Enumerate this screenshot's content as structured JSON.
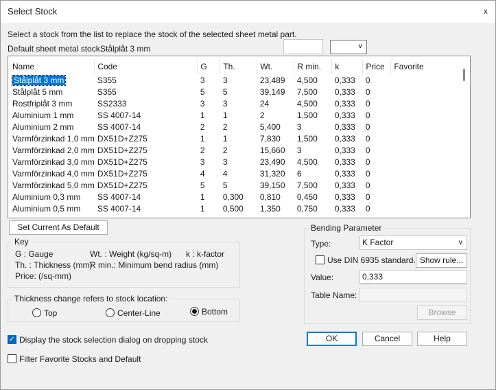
{
  "window": {
    "title": "Select Stock",
    "close_glyph": "x"
  },
  "instruction": "Select a stock from the list to replace the stock of the selected sheet metal part.",
  "default_stock": {
    "label": "Default sheet metal stock:",
    "value": "Stålplåt 3 mm"
  },
  "columns": [
    "Name",
    "Code",
    "G",
    "Th.",
    "Wt.",
    "R min.",
    "k",
    "Price",
    "Favorite"
  ],
  "rows": [
    [
      "Stålplåt 3 mm",
      "S355",
      "3",
      "3",
      "23,489",
      "4,500",
      "0,333",
      "0",
      ""
    ],
    [
      "Stålplåt 5 mm",
      "S355",
      "5",
      "5",
      "39,149",
      "7,500",
      "0,333",
      "0",
      ""
    ],
    [
      "Rostfriplåt 3 mm",
      "SS2333",
      "3",
      "3",
      "24",
      "4,500",
      "0,333",
      "0",
      ""
    ],
    [
      "Aluminium 1 mm",
      "SS 4007-14",
      "1",
      "1",
      "2",
      "1,500",
      "0,333",
      "0",
      ""
    ],
    [
      "Aluminium 2 mm",
      "SS 4007-14",
      "2",
      "2",
      "5,400",
      "3",
      "0,333",
      "0",
      ""
    ],
    [
      "Varmförzinkad 1,0 mm",
      "DX51D+Z275",
      "1",
      "1",
      "7,830",
      "1,500",
      "0,333",
      "0",
      ""
    ],
    [
      "Varmförzinkad 2,0 mm",
      "DX51D+Z275",
      "2",
      "2",
      "15,660",
      "3",
      "0,333",
      "0",
      ""
    ],
    [
      "Varmförzinkad 3,0 mm",
      "DX51D+Z275",
      "3",
      "3",
      "23,490",
      "4,500",
      "0,333",
      "0",
      ""
    ],
    [
      "Varmförzinkad 4,0 mm",
      "DX51D+Z275",
      "4",
      "4",
      "31,320",
      "6",
      "0,333",
      "0",
      ""
    ],
    [
      "Varmförzinkad 5,0 mm",
      "DX51D+Z275",
      "5",
      "5",
      "39,150",
      "7,500",
      "0,333",
      "0",
      ""
    ],
    [
      "Aluminium 0,3 mm",
      "SS 4007-14",
      "1",
      "0,300",
      "0,810",
      "0,450",
      "0,333",
      "0",
      ""
    ],
    [
      "Aluminium 0,5 mm",
      "SS 4007-14",
      "1",
      "0,500",
      "1,350",
      "0,750",
      "0,333",
      "0",
      ""
    ]
  ],
  "selected_row": 0,
  "set_default_button": "Set Current As Default",
  "key": {
    "title": "Key",
    "gauge": "G : Gauge",
    "weight": "Wt. : Weight (kg/sq-m)",
    "kfactor": "k : k-factor",
    "thickness": "Th. : Thickness (mm)",
    "rmin": "R min.: Minimum bend radius (mm)",
    "price": "Price: (/sq-mm)"
  },
  "thickness": {
    "title": "Thickness change refers to stock location:",
    "options": [
      "Top",
      "Center-Line",
      "Bottom"
    ],
    "selected": "Bottom"
  },
  "bending": {
    "title": "Bending Parameter",
    "type_label": "Type:",
    "type_value": "K Factor",
    "din_label": "Use DIN 6935 standard.",
    "din_checked": false,
    "show_rule": "Show rule...",
    "value_label": "Value:",
    "value": "0,333",
    "table_label": "Table Name:",
    "table_value": "",
    "browse": "Browse"
  },
  "display_check": {
    "label": "Display the stock selection dialog on dropping stock",
    "checked": true
  },
  "filter_check": {
    "label": "Filter Favorite Stocks and Default",
    "checked": false
  },
  "buttons": {
    "ok": "OK",
    "cancel": "Cancel",
    "help": "Help"
  },
  "colors": {
    "selection": "#0078d7",
    "focus_border": "#0078d7"
  }
}
